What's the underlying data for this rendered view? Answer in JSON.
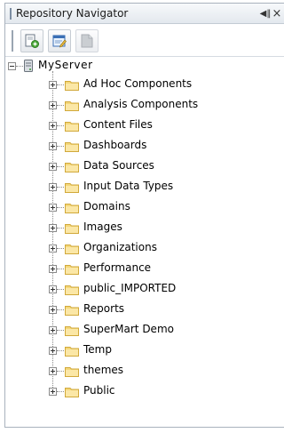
{
  "panel": {
    "title": "Repository Navigator",
    "pin_glyph": "◀‖",
    "close_glyph": "×"
  },
  "toolbar": {
    "buttons": [
      {
        "icon": "new-resource-icon",
        "enabled": true
      },
      {
        "icon": "edit-resource-icon",
        "enabled": true
      },
      {
        "icon": "resource-disabled-icon",
        "enabled": false
      }
    ]
  },
  "tree": {
    "root": {
      "label": "MyServer",
      "icon": "server-icon",
      "expanded": true
    },
    "children": [
      {
        "label": "Ad Hoc Components",
        "icon": "folder-icon"
      },
      {
        "label": "Analysis Components",
        "icon": "folder-icon"
      },
      {
        "label": "Content Files",
        "icon": "folder-icon"
      },
      {
        "label": "Dashboards",
        "icon": "folder-icon"
      },
      {
        "label": "Data Sources",
        "icon": "folder-icon"
      },
      {
        "label": "Input Data Types",
        "icon": "folder-icon"
      },
      {
        "label": "Domains",
        "icon": "folder-icon"
      },
      {
        "label": "Images",
        "icon": "folder-icon"
      },
      {
        "label": "Organizations",
        "icon": "folder-icon"
      },
      {
        "label": "Performance",
        "icon": "folder-icon"
      },
      {
        "label": "public_IMPORTED",
        "icon": "folder-icon"
      },
      {
        "label": "Reports",
        "icon": "folder-icon"
      },
      {
        "label": "SuperMart Demo",
        "icon": "folder-icon"
      },
      {
        "label": "Temp",
        "icon": "folder-icon"
      },
      {
        "label": "themes",
        "icon": "folder-icon"
      },
      {
        "label": "Public",
        "icon": "folder-icon"
      }
    ]
  },
  "colors": {
    "folder_fill": "#f4d77a",
    "folder_edge": "#d1a93b",
    "titlebar_top": "#f7f9fb",
    "titlebar_bottom": "#e3e8ee",
    "panel_border": "#a9b2bd"
  }
}
